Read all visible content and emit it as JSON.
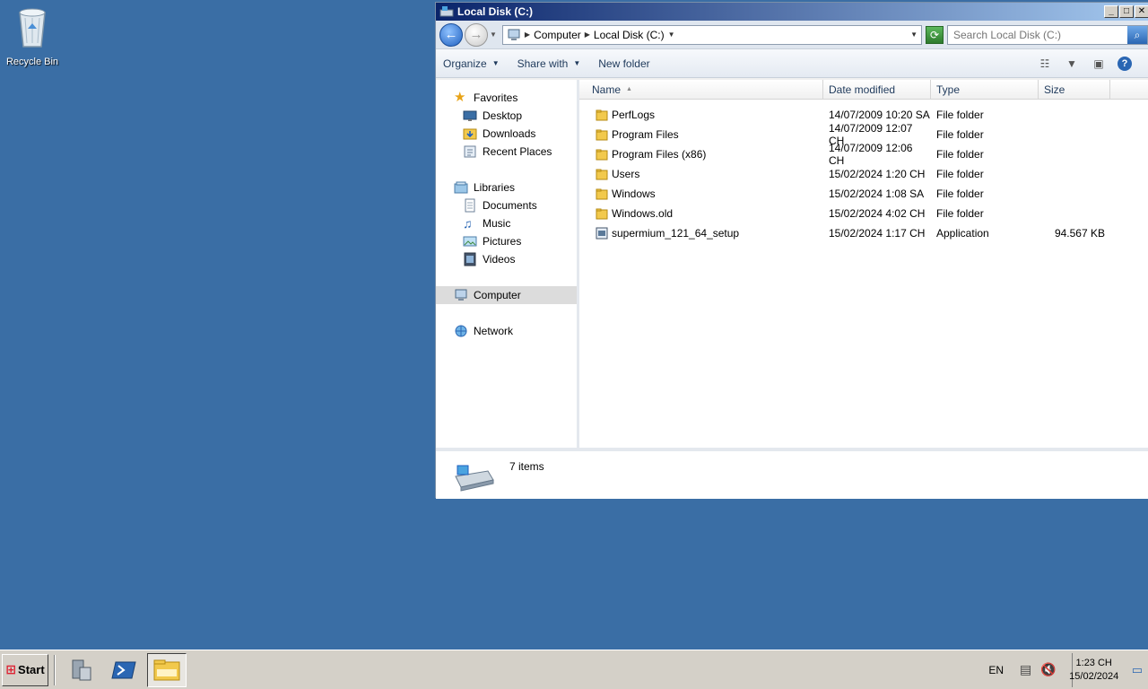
{
  "desktop": {
    "recycle_bin_label": "Recycle Bin"
  },
  "window": {
    "title": "Local Disk (C:)",
    "buttons": {
      "minimize": "_",
      "maximize": "□",
      "close": "✕"
    }
  },
  "address": {
    "crumbs": [
      "Computer",
      "Local Disk (C:)"
    ],
    "search_placeholder": "Search Local Disk (C:)"
  },
  "toolbar": {
    "organize": "Organize",
    "share_with": "Share with",
    "new_folder": "New folder"
  },
  "nav": {
    "favorites": "Favorites",
    "desktop": "Desktop",
    "downloads": "Downloads",
    "recent_places": "Recent Places",
    "libraries": "Libraries",
    "documents": "Documents",
    "music": "Music",
    "pictures": "Pictures",
    "videos": "Videos",
    "computer": "Computer",
    "network": "Network"
  },
  "columns": {
    "name": "Name",
    "date": "Date modified",
    "type": "Type",
    "size": "Size"
  },
  "files": [
    {
      "name": "PerfLogs",
      "date": "14/07/2009 10:20 SA",
      "type": "File folder",
      "size": "",
      "icon": "folder-icon"
    },
    {
      "name": "Program Files",
      "date": "14/07/2009 12:07 CH",
      "type": "File folder",
      "size": "",
      "icon": "folder-icon"
    },
    {
      "name": "Program Files (x86)",
      "date": "14/07/2009 12:06 CH",
      "type": "File folder",
      "size": "",
      "icon": "folder-icon"
    },
    {
      "name": "Users",
      "date": "15/02/2024 1:20 CH",
      "type": "File folder",
      "size": "",
      "icon": "folder-icon"
    },
    {
      "name": "Windows",
      "date": "15/02/2024 1:08 SA",
      "type": "File folder",
      "size": "",
      "icon": "folder-icon"
    },
    {
      "name": "Windows.old",
      "date": "15/02/2024 4:02 CH",
      "type": "File folder",
      "size": "",
      "icon": "folder-icon"
    },
    {
      "name": "supermium_121_64_setup",
      "date": "15/02/2024 1:17 CH",
      "type": "Application",
      "size": "94.567 KB",
      "icon": "application-icon"
    }
  ],
  "details": {
    "count": "7 items"
  },
  "taskbar": {
    "start": "Start",
    "lang": "EN",
    "time": "1:23 CH",
    "date": "15/02/2024"
  },
  "colors": {
    "desktop": "#3a6ea5",
    "titlebar_start": "#0a246a",
    "titlebar_end": "#a6caf0",
    "folder": "#f2c94c"
  }
}
